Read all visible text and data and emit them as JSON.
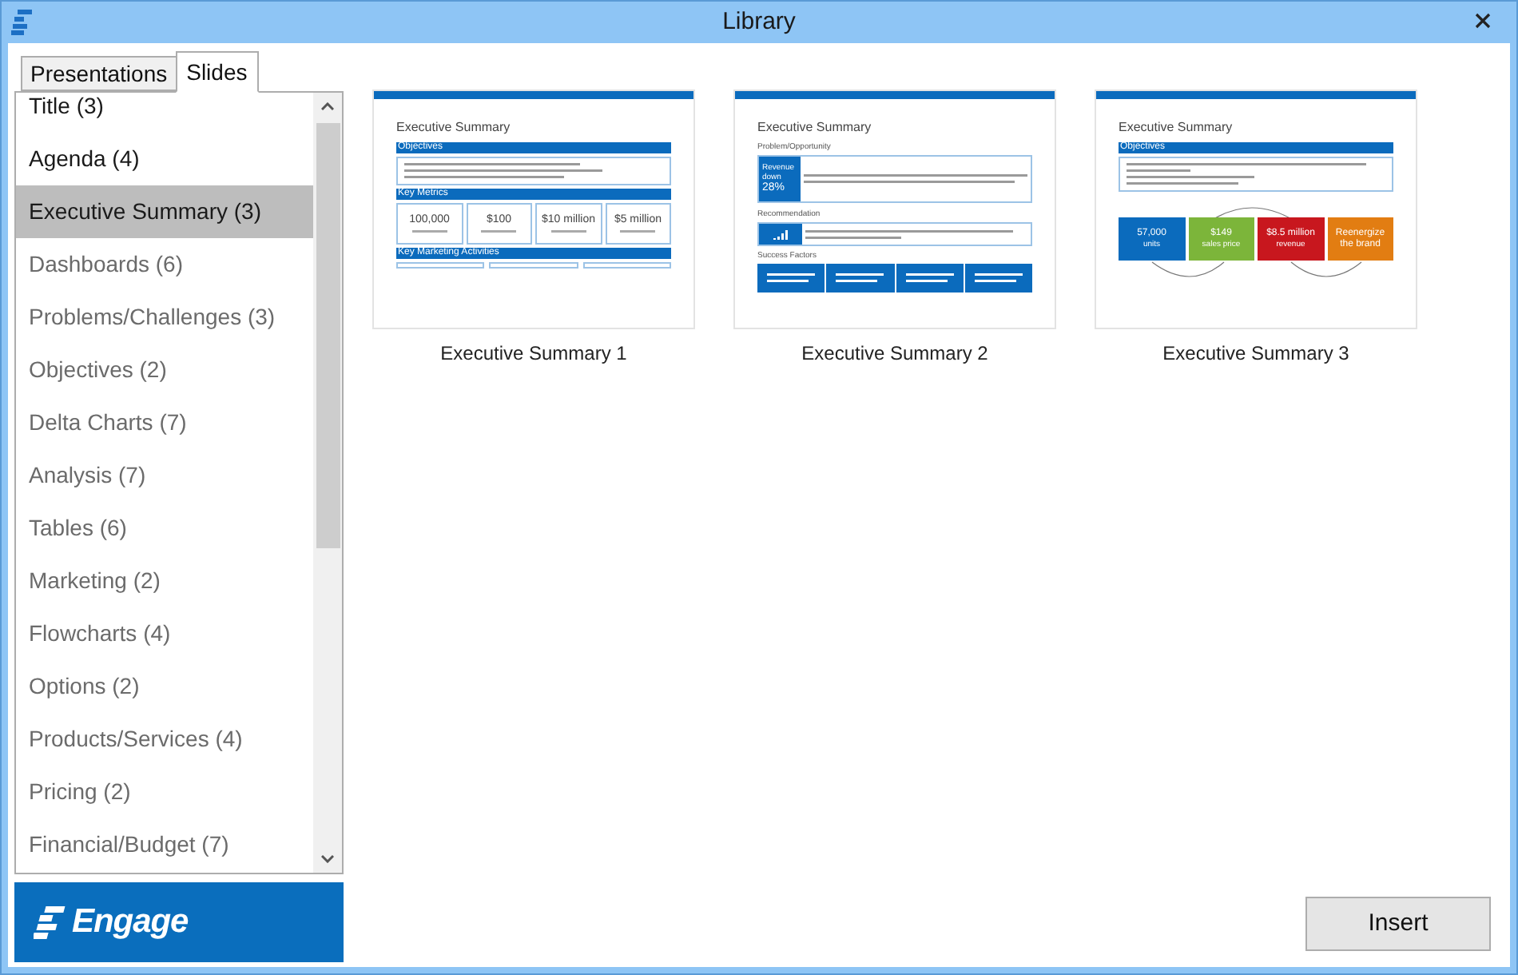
{
  "window": {
    "title": "Library"
  },
  "tabs": [
    {
      "label": "Presentations",
      "selected": false
    },
    {
      "label": "Slides",
      "selected": true
    }
  ],
  "slide_categories": [
    {
      "label": "Title (3)",
      "selected": false,
      "dimmed": false
    },
    {
      "label": "Agenda (4)",
      "selected": false,
      "dimmed": false
    },
    {
      "label": "Executive Summary (3)",
      "selected": true,
      "dimmed": false
    },
    {
      "label": "Dashboards (6)",
      "selected": false,
      "dimmed": true
    },
    {
      "label": "Problems/Challenges (3)",
      "selected": false,
      "dimmed": true
    },
    {
      "label": "Objectives (2)",
      "selected": false,
      "dimmed": true
    },
    {
      "label": "Delta Charts (7)",
      "selected": false,
      "dimmed": true
    },
    {
      "label": "Analysis (7)",
      "selected": false,
      "dimmed": true
    },
    {
      "label": "Tables (6)",
      "selected": false,
      "dimmed": true
    },
    {
      "label": "Marketing (2)",
      "selected": false,
      "dimmed": true
    },
    {
      "label": "Flowcharts (4)",
      "selected": false,
      "dimmed": true
    },
    {
      "label": "Options (2)",
      "selected": false,
      "dimmed": true
    },
    {
      "label": "Products/Services (4)",
      "selected": false,
      "dimmed": true
    },
    {
      "label": "Pricing (2)",
      "selected": false,
      "dimmed": true
    },
    {
      "label": "Financial/Budget (7)",
      "selected": false,
      "dimmed": true
    }
  ],
  "logo": {
    "text": "Engage"
  },
  "thumbnails": [
    {
      "caption": "Executive Summary 1",
      "slide": {
        "kind": "metrics",
        "title": "Executive Summary",
        "objectives_heading": "Objectives",
        "metrics_heading": "Key Metrics",
        "metrics": [
          "100,000",
          "$100",
          "$10 million",
          "$5 million"
        ],
        "activities_heading": "Key Marketing Activities"
      }
    },
    {
      "caption": "Executive Summary 2",
      "slide": {
        "kind": "problem",
        "title": "Executive Summary",
        "problem_heading": "Problem/Opportunity",
        "badge_label": "Revenue down",
        "badge_value": "28%",
        "recommendation_heading": "Recommendation",
        "factors_heading": "Success Factors"
      }
    },
    {
      "caption": "Executive Summary 3",
      "slide": {
        "kind": "flow",
        "title": "Executive Summary",
        "objectives_heading": "Objectives",
        "boxes": [
          {
            "value": "57,000",
            "label": "units",
            "color": "#0b6bbd"
          },
          {
            "value": "$149",
            "label": "sales price",
            "color": "#7cb53a"
          },
          {
            "value": "$8.5 million",
            "label": "revenue",
            "color": "#c8171e"
          },
          {
            "value": "Reenergize the brand",
            "color": "#e27d12"
          }
        ]
      }
    }
  ],
  "buttons": [
    {
      "label": "Insert"
    }
  ]
}
